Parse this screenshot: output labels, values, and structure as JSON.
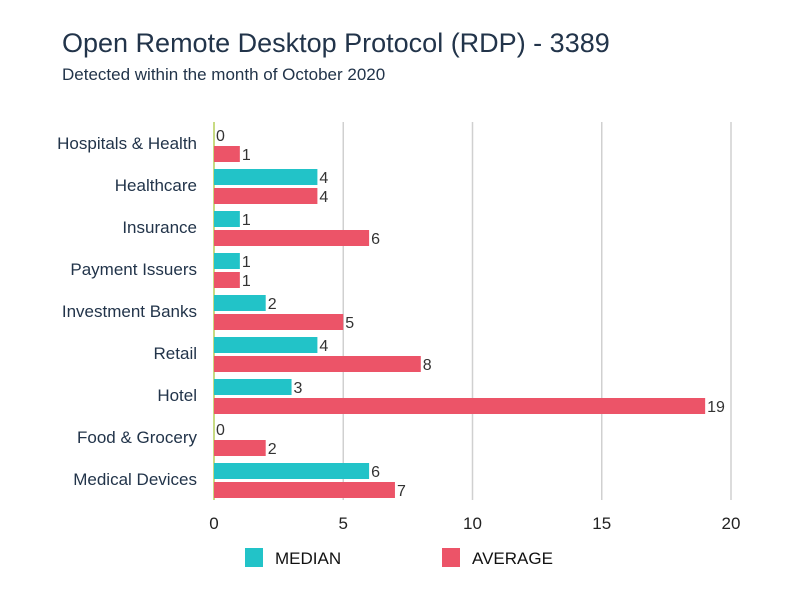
{
  "chart_data": {
    "type": "bar",
    "orientation": "horizontal",
    "title": "Open Remote Desktop Protocol (RDP) - 3389",
    "subtitle": "Detected within the month of October 2020",
    "xlabel": "",
    "ylabel": "",
    "xlim": [
      0,
      20
    ],
    "xticks": [
      0,
      5,
      10,
      15,
      20
    ],
    "grid": true,
    "legend_position": "bottom",
    "categories": [
      "Hospitals & Health",
      "Healthcare",
      "Insurance",
      "Payment Issuers",
      "Investment Banks",
      "Retail",
      "Hotel",
      "Food & Grocery",
      "Medical Devices"
    ],
    "series": [
      {
        "name": "MEDIAN",
        "color": "#22c3c8",
        "values": [
          0,
          4,
          1,
          1,
          2,
          4,
          3,
          0,
          6
        ]
      },
      {
        "name": "AVERAGE",
        "color": "#ec5468",
        "values": [
          1,
          4,
          6,
          1,
          5,
          8,
          19,
          2,
          7
        ]
      }
    ]
  }
}
